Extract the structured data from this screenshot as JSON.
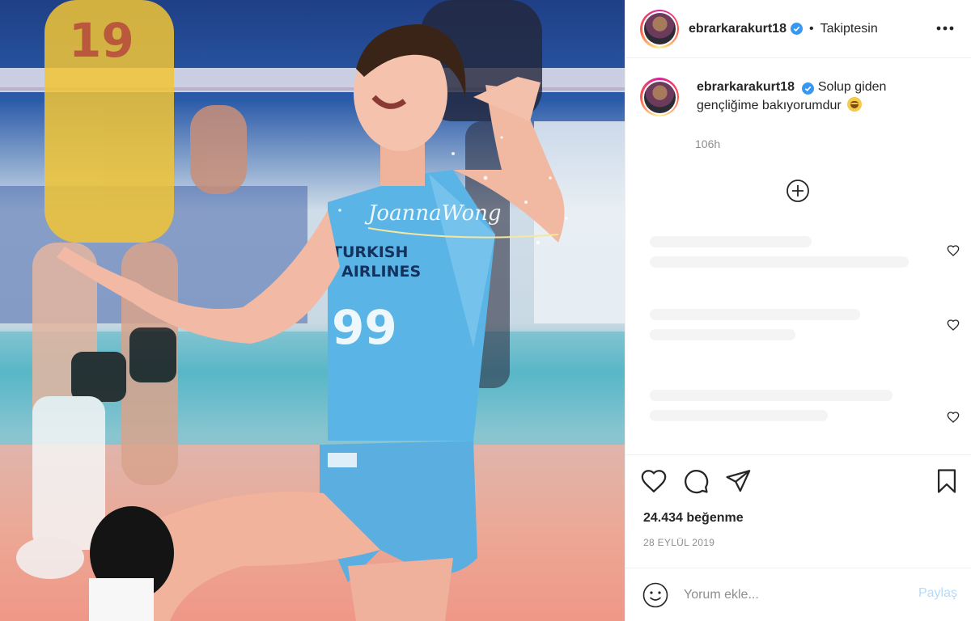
{
  "header": {
    "username": "ebrarkarakurt18",
    "follow_status": "Takiptesin",
    "separator": "•"
  },
  "caption": {
    "username": "ebrarkarakurt18",
    "text": "Solup giden gençliğime bakıyorumdur",
    "time_ago": "106h"
  },
  "media": {
    "watermark": "JoannaWong",
    "jersey_sponsor_line1": "TURKISH",
    "jersey_sponsor_line2": "AIRLINES",
    "jersey_number": "99",
    "background_jersey_number": "19"
  },
  "engagement": {
    "likes": "24.434 beğenme",
    "date": "28 EYLÜL 2019"
  },
  "comment": {
    "placeholder": "Yorum ekle...",
    "share_label": "Paylaş"
  },
  "icons": {
    "more": "more-options-icon",
    "verified": "verified-badge-icon",
    "load_more": "plus-circle-icon",
    "like": "heart-icon",
    "comment": "comment-icon",
    "share": "paper-plane-icon",
    "save": "bookmark-icon",
    "emoji": "smiley-icon"
  },
  "colors": {
    "verified_blue": "#3897f0",
    "share_disabled": "#b3dbff",
    "muted_text": "#8e8e8e",
    "jersey_blue": "#5ab4e6"
  }
}
